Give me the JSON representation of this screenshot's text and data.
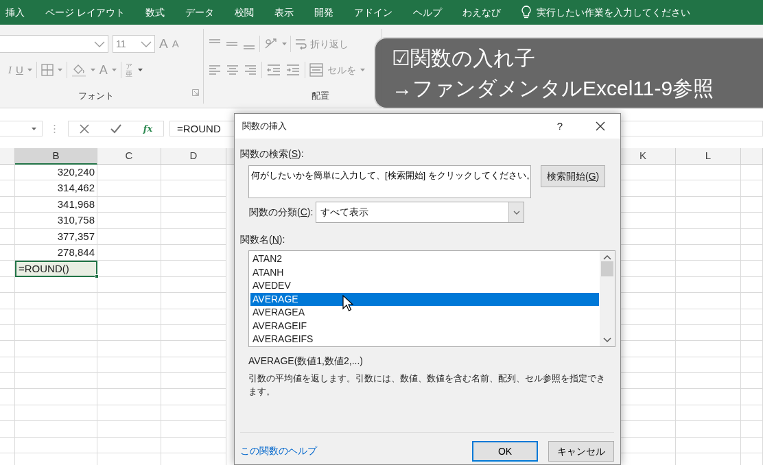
{
  "ribbon_tabs": [
    "挿入",
    "ページ レイアウト",
    "数式",
    "データ",
    "校閲",
    "表示",
    "開発",
    "アドイン",
    "ヘルプ",
    "わえなび"
  ],
  "tell_me": "実行したい作業を入力してください",
  "ribbon": {
    "font_size": "11",
    "grow_font": "A",
    "shrink_font": "A",
    "italic": "I",
    "underline": "U",
    "font_color": "A",
    "phonetic": "ア亜",
    "wrap_text": "折り返し",
    "merge_center": "セルを",
    "groups": [
      "フォント",
      "配置"
    ]
  },
  "formula_bar": {
    "fx": "fx",
    "formula": "=ROUND"
  },
  "sheet": {
    "columns_left": [
      {
        "label": "B",
        "selected": true
      },
      {
        "label": "C",
        "selected": false
      },
      {
        "label": "D",
        "selected": false
      }
    ],
    "columns_right": [
      {
        "label": "K",
        "selected": false
      },
      {
        "label": "L",
        "selected": false
      }
    ],
    "rows": [
      {
        "value": "320,240",
        "selected": false
      },
      {
        "value": "314,462",
        "selected": false
      },
      {
        "value": "341,968",
        "selected": false
      },
      {
        "value": "310,758",
        "selected": false
      },
      {
        "value": "377,357",
        "selected": false
      },
      {
        "value": "278,844",
        "selected": false
      },
      {
        "value": "=ROUND()",
        "selected": true
      }
    ]
  },
  "dialog": {
    "title": "関数の挿入",
    "help": "?",
    "search_label": {
      "before": "関数の検索(",
      "key": "S",
      "after": "):"
    },
    "search_value": "何がしたいかを簡単に入力して、[検索開始] をクリックしてください。",
    "search_button": {
      "before": "検索開始(",
      "key": "G",
      "after": ")"
    },
    "category_label": {
      "before": "関数の分類(",
      "key": "C",
      "after": "):"
    },
    "category_value": "すべて表示",
    "list_label": {
      "before": "関数名(",
      "key": "N",
      "after": "):"
    },
    "functions": [
      {
        "label": "ATAN2",
        "selected": false
      },
      {
        "label": "ATANH",
        "selected": false
      },
      {
        "label": "AVEDEV",
        "selected": false
      },
      {
        "label": "AVERAGE",
        "selected": true
      },
      {
        "label": "AVERAGEA",
        "selected": false
      },
      {
        "label": "AVERAGEIF",
        "selected": false
      },
      {
        "label": "AVERAGEIFS",
        "selected": false
      }
    ],
    "syntax": "AVERAGE(数値1,数値2,...)",
    "description": "引数の平均値を返します。引数には、数値、数値を含む名前、配列、セル参照を指定できます。",
    "help_link": "この関数のヘルプ",
    "buttons": [
      {
        "label": "OK",
        "default": true
      },
      {
        "label": "キャンセル",
        "default": false
      }
    ]
  },
  "caption": [
    "☑関数の入れ子",
    "→ファンダメンタルExcel11-9参照"
  ]
}
